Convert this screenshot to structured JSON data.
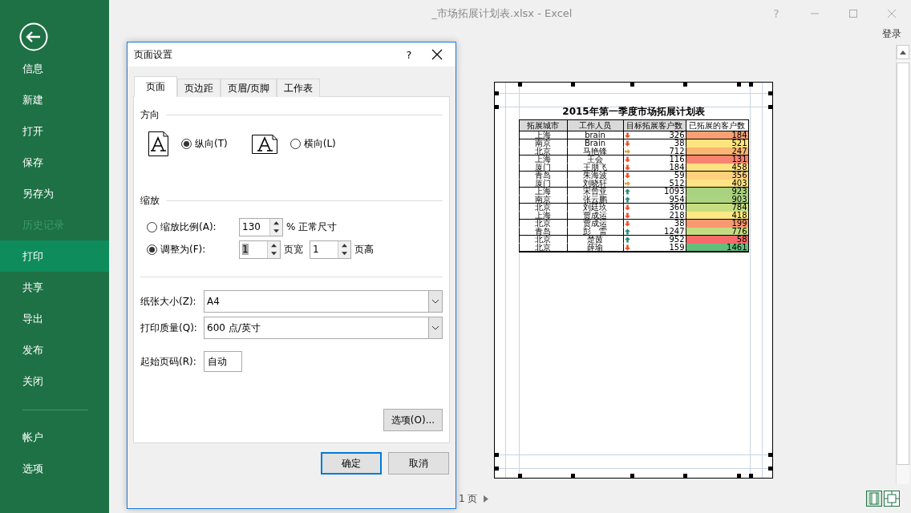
{
  "window": {
    "title": "_市场拓展计划表.xlsx - Excel",
    "help": "?",
    "sign_in": "登录"
  },
  "sidebar": {
    "items": [
      {
        "label": "信息",
        "selected": false,
        "disabled": false
      },
      {
        "label": "新建",
        "selected": false,
        "disabled": false
      },
      {
        "label": "打开",
        "selected": false,
        "disabled": false
      },
      {
        "label": "保存",
        "selected": false,
        "disabled": false
      },
      {
        "label": "另存为",
        "selected": false,
        "disabled": false
      },
      {
        "label": "历史记录",
        "selected": false,
        "disabled": true
      },
      {
        "label": "打印",
        "selected": true,
        "disabled": false
      },
      {
        "label": "共享",
        "selected": false,
        "disabled": false
      },
      {
        "label": "导出",
        "selected": false,
        "disabled": false
      },
      {
        "label": "发布",
        "selected": false,
        "disabled": false
      },
      {
        "label": "关闭",
        "selected": false,
        "disabled": false
      }
    ],
    "footer_items": [
      {
        "label": "帐户",
        "selected": false,
        "disabled": false
      },
      {
        "label": "选项",
        "selected": false,
        "disabled": false
      }
    ]
  },
  "preview": {
    "title": "2015年第一季度市场拓展计划表",
    "columns": [
      "拓展城市",
      "工作人员",
      "目标拓展客户数",
      "已拓展的客户数"
    ],
    "rows": [
      {
        "city": "上海",
        "person": "brain",
        "kind": "down",
        "target": "326",
        "done": "184",
        "color": "#f9a072",
        "rule_below": true
      },
      {
        "city": "南京",
        "person": "Brain",
        "kind": "down",
        "target": "38",
        "done": "521",
        "color": "#fde47f",
        "rule_below": false
      },
      {
        "city": "北京",
        "person": "马艳锋",
        "kind": "right",
        "target": "712",
        "done": "247",
        "color": "#fbb574",
        "rule_below": true
      },
      {
        "city": "上海",
        "person": "王会",
        "kind": "down",
        "target": "116",
        "done": "131",
        "color": "#f8836f",
        "rule_below": false
      },
      {
        "city": "厦门",
        "person": "王朋飞",
        "kind": "down",
        "target": "184",
        "done": "458",
        "color": "#fee282",
        "rule_below": true
      },
      {
        "city": "青岛",
        "person": "朱海波",
        "kind": "down",
        "target": "59",
        "done": "356",
        "color": "#fdd17e",
        "rule_below": false
      },
      {
        "city": "厦门",
        "person": "刘晓轩",
        "kind": "right",
        "target": "512",
        "done": "403",
        "color": "#fee383",
        "rule_below": true
      },
      {
        "city": "上海",
        "person": "宋曾亚",
        "kind": "up",
        "target": "1093",
        "done": "923",
        "color": "#a8d27f",
        "rule_below": false
      },
      {
        "city": "南京",
        "person": "张云鹏",
        "kind": "up",
        "target": "954",
        "done": "903",
        "color": "#acd480",
        "rule_below": true
      },
      {
        "city": "北京",
        "person": "刘廷玖",
        "kind": "down",
        "target": "360",
        "done": "784",
        "color": "#c6dd80",
        "rule_below": false
      },
      {
        "city": "上海",
        "person": "贾成运",
        "kind": "down",
        "target": "218",
        "done": "418",
        "color": "#fee884",
        "rule_below": true
      },
      {
        "city": "北京",
        "person": "贾成运",
        "kind": "down",
        "target": "38",
        "done": "199",
        "color": "#f99870",
        "rule_below": false
      },
      {
        "city": "青岛",
        "person": "彭　雷",
        "kind": "up",
        "target": "1247",
        "done": "776",
        "color": "#c4dc80",
        "rule_below": true
      },
      {
        "city": "北京",
        "person": "楚茵",
        "kind": "up",
        "target": "952",
        "done": "58",
        "color": "#f8696b",
        "rule_below": false
      },
      {
        "city": "北京",
        "person": "薛瑜",
        "kind": "down",
        "target": "159",
        "done": "1461",
        "color": "#63be7b",
        "rule_below": true
      }
    ]
  },
  "page_nav": {
    "label": "1 页"
  },
  "dialog": {
    "title": "页面设置",
    "help": "?",
    "tabs": [
      {
        "label": "页面",
        "selected": true
      },
      {
        "label": "页边距",
        "selected": false
      },
      {
        "label": "页眉/页脚",
        "selected": false
      },
      {
        "label": "工作表",
        "selected": false
      }
    ],
    "orientation": {
      "heading": "方向",
      "options": [
        {
          "kind": "portrait",
          "label": "纵向(T)",
          "selected": true
        },
        {
          "kind": "landscape",
          "label": "横向(L)",
          "selected": false
        }
      ]
    },
    "scaling": {
      "heading": "缩放",
      "percent": {
        "label": "缩放比例(A):",
        "selected": false,
        "value": "130",
        "unit": "% 正常尺寸"
      },
      "fit": {
        "label": "调整为(F):",
        "selected": true,
        "wide": {
          "value": "1",
          "text_selected": true
        },
        "wide_unit": "页宽",
        "tall": {
          "value": "1",
          "text_selected": false
        },
        "tall_unit": "页高"
      }
    },
    "paper_size": {
      "label": "纸张大小(Z):",
      "value": "A4"
    },
    "print_quality": {
      "label": "打印质量(Q):",
      "value": "600 点/英寸"
    },
    "first_page": {
      "label": "起始页码(R):",
      "value": "自动"
    },
    "buttons": [
      {
        "label": "选项(O)...",
        "default": false
      },
      {
        "label": "确定",
        "default": true
      },
      {
        "label": "取消",
        "default": false
      }
    ]
  }
}
